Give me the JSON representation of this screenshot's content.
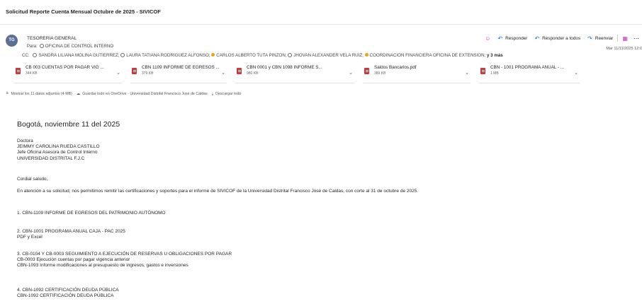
{
  "subject": "Solicitud Reporte Cuenta Mensual Octubre de 2025 - SIVICOF",
  "sender": {
    "avatar_initials": "TG",
    "name": "TESORERIA GENERAL"
  },
  "to": {
    "prefix": "Para:",
    "recipient": "OFICINA DE CONTROL INTERNO"
  },
  "cc": {
    "prefix": "CC:",
    "recipients": [
      "SANDRA LILIANA MOLINA GUTIERREZ;",
      "LAURA TATIANA RODRIGUEZ ALFONSO;",
      "CARLOS ALBERTO TUTA PINZON;",
      "JHOVAN ALEXANDER VELA RUIZ;",
      "COORDINACION FINANCIERA OFICINA DE EXTENSION;"
    ],
    "more": "y 3 más"
  },
  "actions": {
    "reply": "Responder",
    "reply_all": "Responder a todos",
    "forward": "Reenviar"
  },
  "date": "Mar 11/11/2025 12:0",
  "attachments": [
    {
      "name": "CB 003 CUENTAS POR PAGAR VIG ...",
      "size": "344 KB"
    },
    {
      "name": "CBN 1109 INFORME DE EGRESOS ...",
      "size": "379 KB"
    },
    {
      "name": "CBN 0001 y CBN 1098 INFORME S...",
      "size": "980 KB"
    },
    {
      "name": "Saldos Bancarios.pdf",
      "size": "389 KB"
    },
    {
      "name": "CBN - 1001 PROGRAMA ANUAL - ...",
      "size": "1 MB"
    }
  ],
  "attachment_actions": {
    "show_all": "Mostrar los 11 datos adjuntos (4 MB)",
    "save_onedrive": "Guardar todo en OneDrive - Universidad Distrital Francisco José de Caldas",
    "download_all": "Descargar todo"
  },
  "body": {
    "date_line": "Bogotá, noviembre 11 del 2025",
    "salutation_lines": [
      "Doctora",
      "JEIMMY CAROLINA RUEDA CASTILLO",
      "Jefe Oficina Asesora de Control Interno",
      "UNIVERSIDAD DISTRITAL F.J.C"
    ],
    "cordial": "Cordial saludo,",
    "intro": "En atención a su solicitud, nos permitimos remitir las certificaciones y soportes para el informe de SIVICOF de la Universidad Distrital Francisco José de Caldas, con corte al 31 de octubre de 2025.",
    "items": [
      {
        "title": "1.  CBN-1109 INFORME DE EGRESOS DEL PATRIMONIO AUTÓNOMO",
        "lines": []
      },
      {
        "title": "2. CBN-1001 PROGRAMA ANUAL CAJA - PAC 2025",
        "lines": [
          "PDF y Excel"
        ]
      },
      {
        "title": "3. CB-0104 Y CB-0003 SEGUIMIENTO A EJECUCIÓN DE RESERVAS U OBLIGACIONES POR PAGAR",
        "lines": [
          "CB-0003 Ejecución cuentas por pagar vigencia anterior",
          "CBN-1093 Informe modificaciones al presupuesto de ingresos, gastos e inversiones"
        ]
      },
      {
        "title": "4. CBN-1092 CERTIFICACIÓN DEUDA PÚBLICA",
        "lines": [
          "CBN-1092 CERTIFICACIÓN DEUDA PÚBLICA"
        ]
      }
    ]
  }
}
